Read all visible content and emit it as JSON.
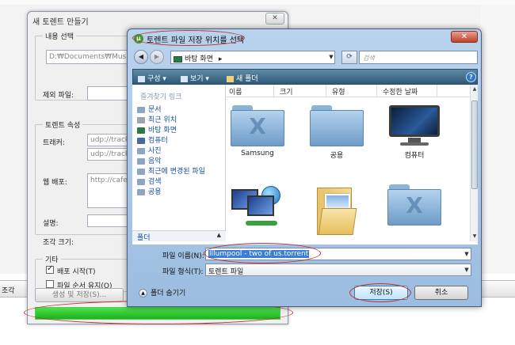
{
  "background": {
    "top_strip_text": "",
    "toolbar_label": "조각"
  },
  "maker": {
    "title": "새 토렌트 만들기",
    "close_label": "✕",
    "content_group": "내용 선택",
    "content_path": "D:₩Documents₩Music₩",
    "exclude_label": "제외 파일:",
    "properties_group": "토렌트 속성",
    "tracker_label": "트래커:",
    "tracker_value_1": "udp://tracke",
    "tracker_value_2": "udp://tracke",
    "web_seed_label": "웹 배포:",
    "web_seed_value": "http://cafe.n",
    "comment_label": "설명:",
    "piece_size_label": "조각 크기:",
    "other_group": "기타",
    "start_seeding_label": "배포 시작(T)",
    "preserve_order_label": "파일 순서 유지(O)",
    "create_button": "생성 및 저장(S)..."
  },
  "dialog": {
    "icon_letter": "µ",
    "title": "토렌트 파일 저장 위치를 선택",
    "close_label": "✕",
    "back_label": "◀",
    "forward_label": "▶",
    "address": "바탕 화면",
    "address_arrow": "▸",
    "search_placeholder": "검색",
    "toolbar": {
      "organize": "구성 ▾",
      "views": "보기 ▾",
      "new_folder": "새 폴더",
      "help": "?"
    },
    "favorites_header": "즐겨찾기 링크",
    "favorites": [
      "문서",
      "최근 위치",
      "바탕 화면",
      "컴퓨터",
      "사진",
      "음악",
      "최근에 변경된 파일",
      "검색",
      "공용"
    ],
    "folders_label": "폴더",
    "folders_arrow": "▲",
    "columns": [
      "이름",
      "크기",
      "유형",
      "수정한 날짜"
    ],
    "items": [
      "Samsung",
      "공용",
      "컴퓨터",
      "",
      "",
      ""
    ],
    "filename_label": "파일 이름(N):",
    "filename_value": "Illumpool - two of us.torrent",
    "filetype_label": "파일 형식(T):",
    "filetype_value": "토렌트 파일",
    "hide_folders": "폴더 숨기기",
    "save_button": "저장(S)",
    "cancel_button": "취소"
  },
  "colors": {
    "progress": "#2fc42f",
    "annotation": "#c03030",
    "dialog_frame": "#9cbde0",
    "command_bar": "#3a6684"
  }
}
